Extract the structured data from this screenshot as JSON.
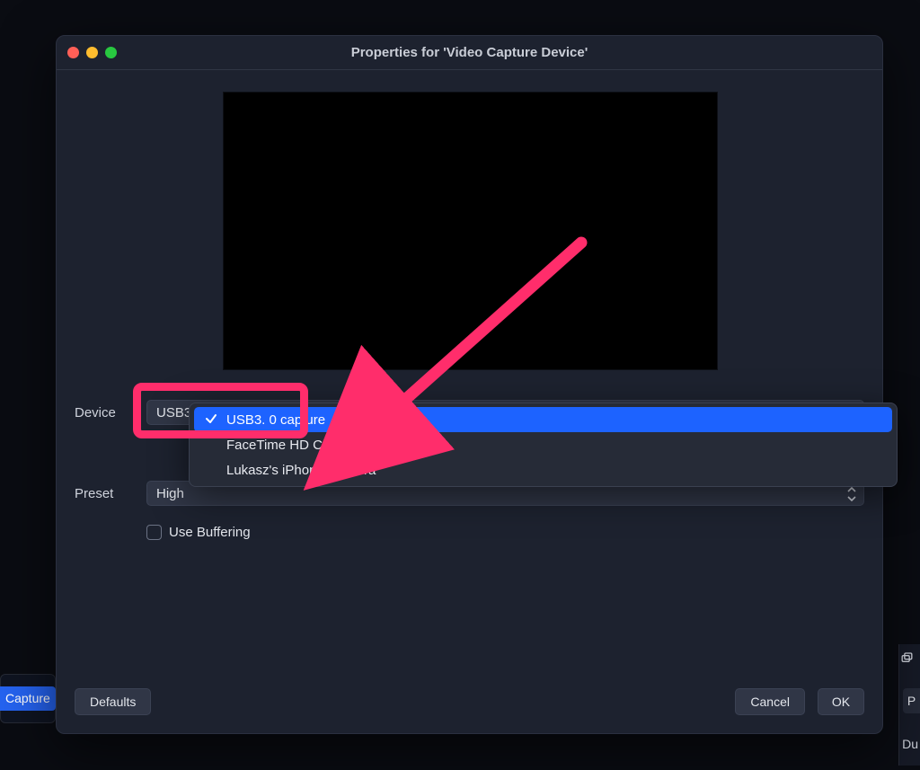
{
  "window": {
    "title": "Properties for 'Video Capture Device'"
  },
  "form": {
    "device_label": "Device",
    "preset_label": "Preset",
    "preset_value": "High",
    "use_buffering_label": "Use Buffering"
  },
  "dropdown": {
    "options": [
      {
        "label": "USB3. 0 capture",
        "selected": true
      },
      {
        "label": "FaceTime HD Camera",
        "selected": false
      },
      {
        "label": "Lukasz's iPhone Camera",
        "selected": false
      }
    ]
  },
  "buttons": {
    "defaults": "Defaults",
    "cancel": "Cancel",
    "ok": "OK"
  },
  "background": {
    "capture_pill_text": "Capture",
    "right_button_text": "P",
    "du_text": "Du"
  },
  "annotation": {
    "color": "#ff2d6b"
  }
}
